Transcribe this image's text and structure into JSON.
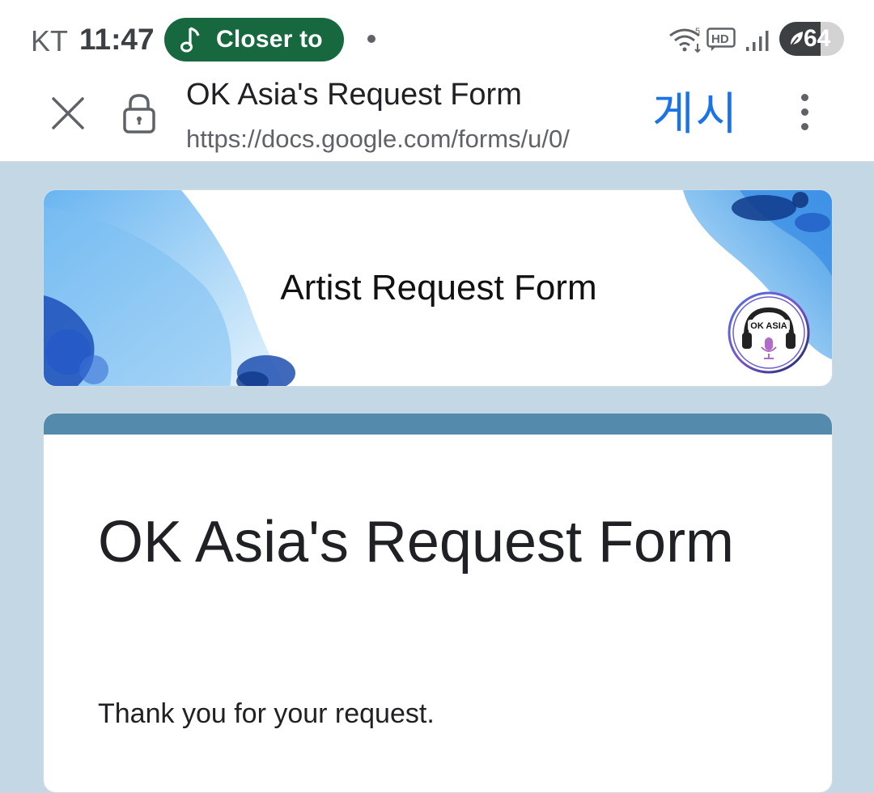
{
  "status_bar": {
    "carrier": "KT",
    "time": "11:47",
    "now_playing": "Closer to",
    "battery_percent": "64",
    "battery_level": 0.64,
    "icons": [
      "music-note-icon",
      "wifi-icon",
      "hd-voice-icon",
      "signal-icon",
      "battery-icon",
      "battery-saver-leaf-icon"
    ]
  },
  "toolbar": {
    "page_title": "OK Asia's Request Form",
    "url": "https://docs.google.com/forms/u/0/",
    "publish_label": "게시",
    "icons": [
      "close-icon",
      "lock-icon",
      "more-vert-icon"
    ]
  },
  "banner": {
    "title": "Artist Request Form",
    "logo_text": "OK ASIA"
  },
  "form": {
    "title": "OK Asia's Request Form",
    "message": "Thank you for your request."
  },
  "colors": {
    "page_background": "#c4d7e5",
    "card_accent": "#548bad",
    "music_pill": "#17683f",
    "publish_blue": "#1a73e8"
  }
}
